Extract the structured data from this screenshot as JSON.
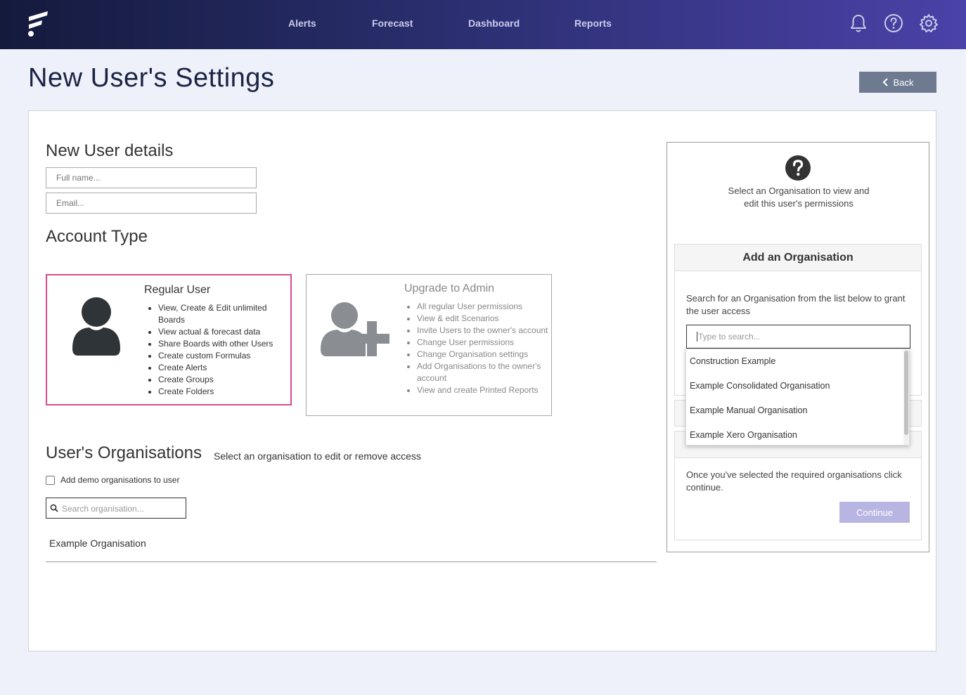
{
  "nav": {
    "items": [
      "Alerts",
      "Forecast",
      "Dashboard",
      "Reports"
    ]
  },
  "page": {
    "title": "New User's Settings",
    "back_label": "Back"
  },
  "details": {
    "heading": "New User details",
    "fullname_placeholder": "Full name...",
    "email_placeholder": "Email..."
  },
  "account_type": {
    "heading": "Account Type",
    "regular": {
      "title": "Regular User",
      "features": [
        "View, Create & Edit unlimited Boards",
        "View actual & forecast data",
        "Share Boards with other Users",
        "Create custom Formulas",
        "Create Alerts",
        "Create Groups",
        "Create Folders"
      ]
    },
    "admin": {
      "title": "Upgrade to Admin",
      "features": [
        "All regular User permissions",
        "View & edit Scenarios",
        "Invite Users to the owner's account",
        "Change User permissions",
        "Change Organisation settings",
        "Add Organisations to the owner's account",
        "View and create Printed Reports"
      ]
    }
  },
  "orgs": {
    "heading": "User's Organisations",
    "subheading": "Select an organisation to edit or remove access",
    "demo_checkbox_label": "Add demo organisations to user",
    "search_placeholder": "Search organisation...",
    "rows": [
      "Example Organisation"
    ]
  },
  "right_panel": {
    "help_text": "Select an Organisation to view and edit this user's permissions",
    "add_org": {
      "header": "Add an Organisation",
      "description": "Search for an Organisation from the list below to grant the user access",
      "search_placeholder": "Type to search..."
    },
    "continue_section": {
      "description": "Once you've selected the required organisations click continue.",
      "button_label": "Continue"
    }
  },
  "dropdown": {
    "options": [
      "Construction Example",
      "Example Consolidated Organisation",
      "Example Manual Organisation",
      "Example Xero Organisation"
    ]
  },
  "colors": {
    "nav_gradient_start": "#141a3c",
    "nav_gradient_end": "#4a42a8",
    "selected_border": "#d84a8c",
    "continue_button": "#b9b5e3",
    "back_button": "#6e7a90"
  }
}
